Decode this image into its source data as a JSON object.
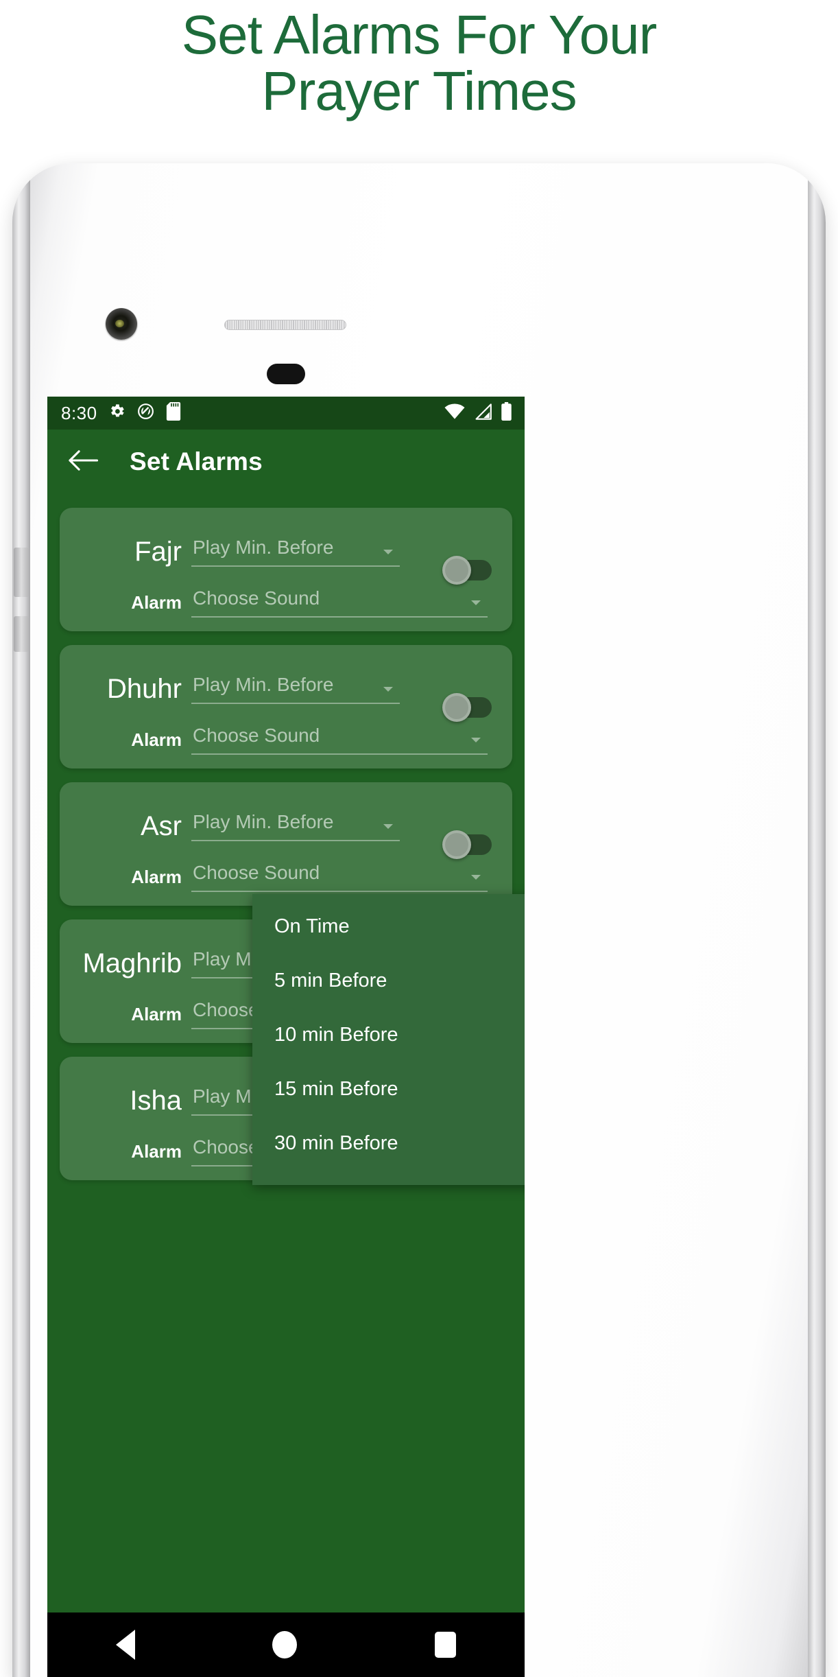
{
  "headline": {
    "line1": "Set Alarms For Your",
    "line2": "Prayer Times",
    "color": "#1d6b3a"
  },
  "colors": {
    "primary": "#1f6022",
    "status_bar": "#164717",
    "menu": "#33693a",
    "card": "rgba(255,255,255,0.17)",
    "nav_bar": "#000000"
  },
  "status_bar": {
    "time": "8:30",
    "icons_left": [
      "gear-icon",
      "do-not-disturb-icon",
      "sd-card-icon"
    ],
    "icons_right": [
      "wifi-icon",
      "cell-signal-icon",
      "battery-icon"
    ]
  },
  "app_bar": {
    "back_icon": "arrow-left-icon",
    "title": "Set Alarms"
  },
  "field_labels": {
    "alarm": "Alarm",
    "play_min_before_placeholder": "Play Min. Before",
    "choose_sound_placeholder": "Choose Sound"
  },
  "prayers": [
    {
      "name": "Fajr",
      "alarm_label": "Alarm",
      "minutes_before": "Play Min. Before",
      "sound": "Choose Sound",
      "enabled": "off"
    },
    {
      "name": "Dhuhr",
      "alarm_label": "Alarm",
      "minutes_before": "Play Min. Before",
      "sound": "Choose Sound",
      "enabled": "off"
    },
    {
      "name": "Asr",
      "alarm_label": "Alarm",
      "minutes_before": "Play Min. Before",
      "sound": "Choose Sound",
      "enabled": "off"
    },
    {
      "name": "Maghrib",
      "alarm_label": "Alarm",
      "minutes_before": "Play Min. Before",
      "sound": "Choose Sound",
      "enabled": "off"
    },
    {
      "name": "Isha",
      "alarm_label": "Alarm",
      "minutes_before": "Play Min. Before",
      "sound": "Choose Sound",
      "enabled": "off"
    }
  ],
  "dropdown": {
    "open_for": "Dhuhr",
    "options": [
      "On Time",
      "5 min Before",
      "10 min Before",
      "15 min Before",
      "30 min Before"
    ]
  },
  "nav_bar": {
    "back": "back-triangle-icon",
    "home": "home-circle-icon",
    "recents": "recents-square-icon"
  }
}
